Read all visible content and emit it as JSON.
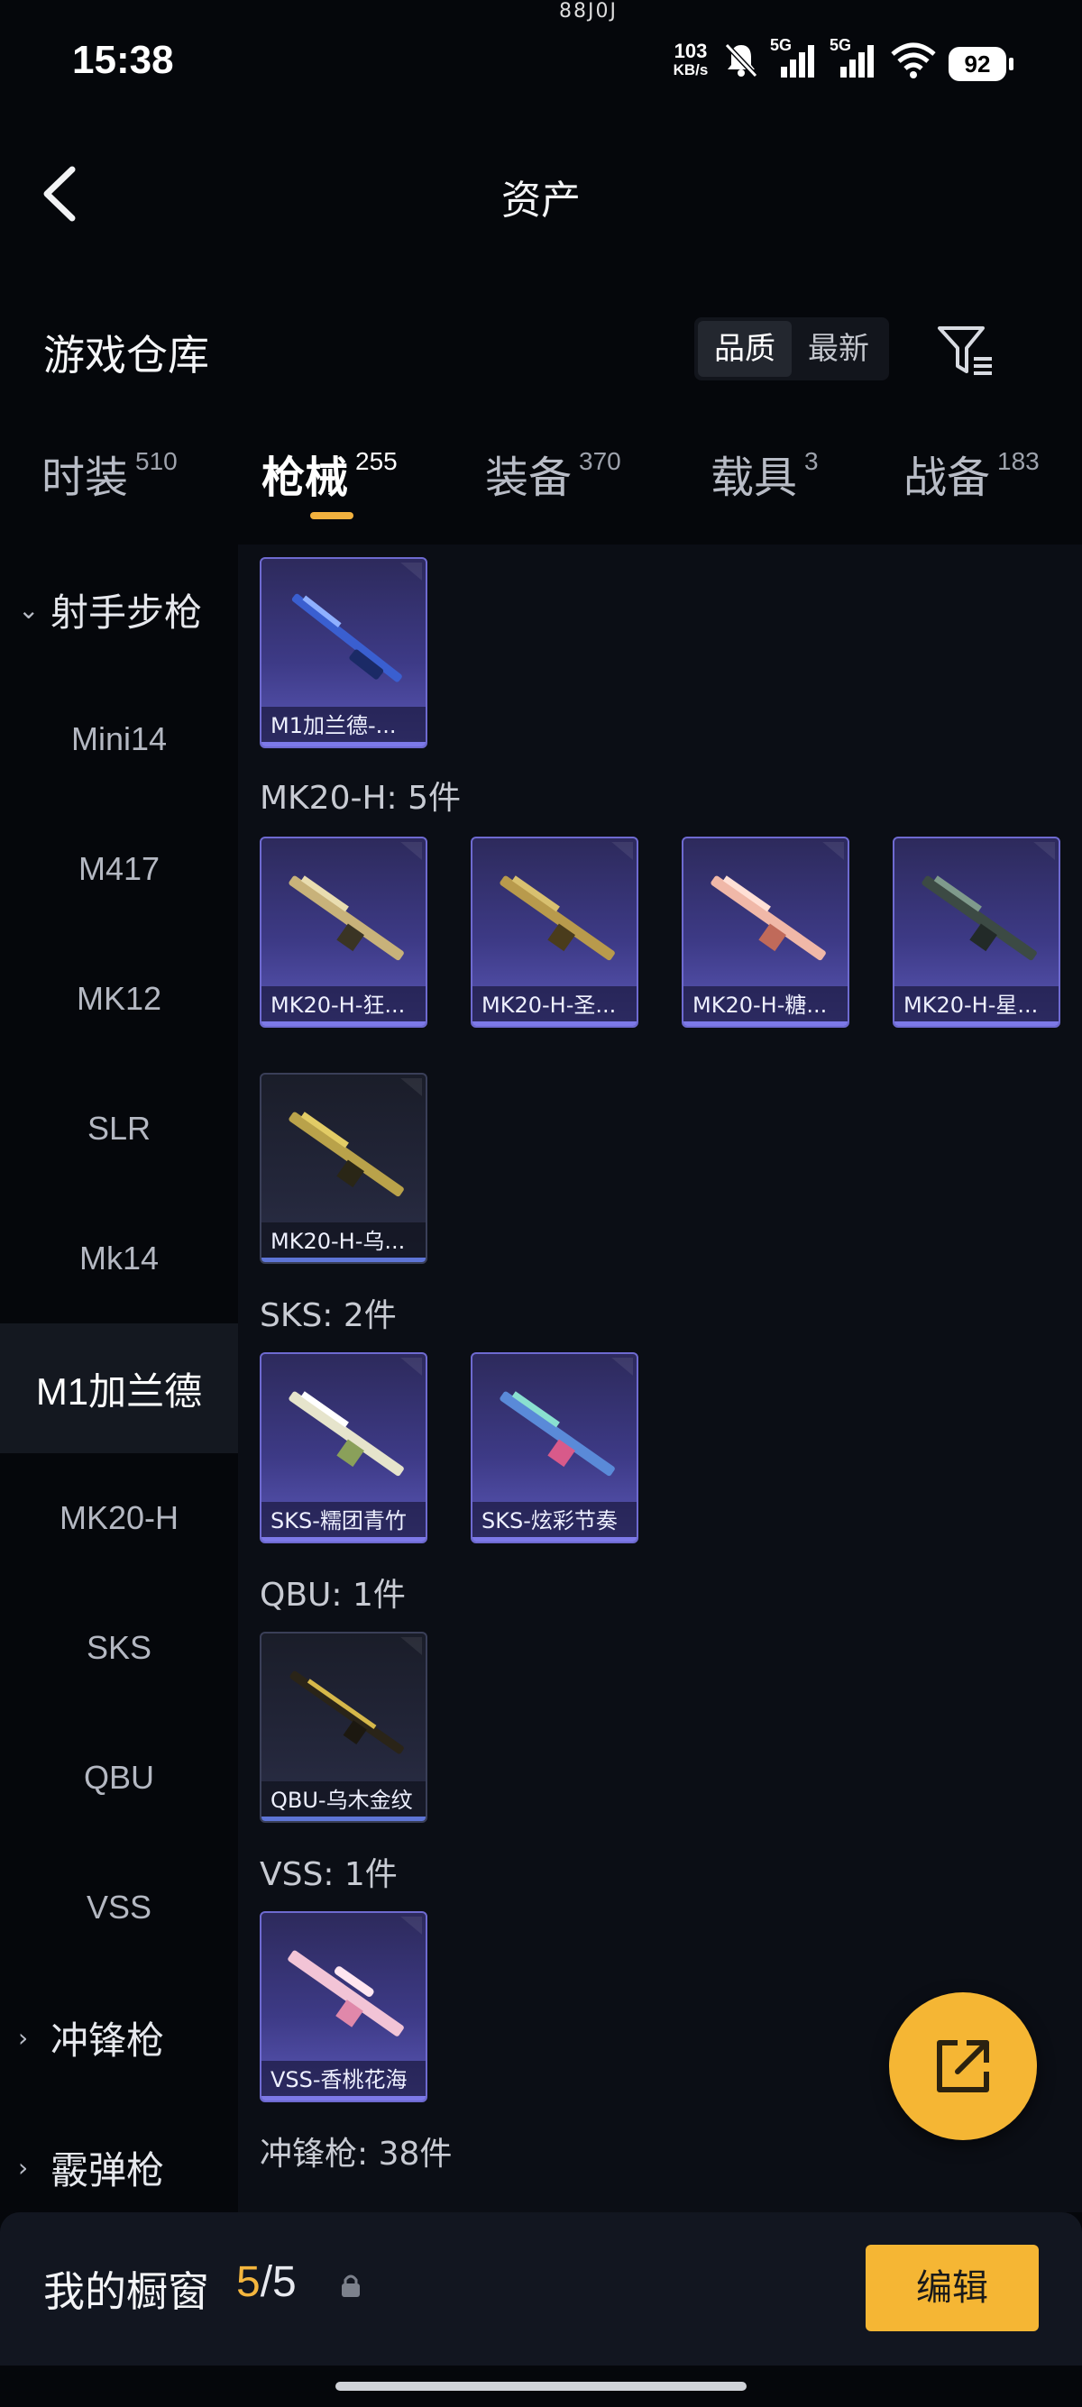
{
  "status_bar": {
    "time": "15:38",
    "top_dots": "88J0J",
    "net_speed_value": "103",
    "net_speed_unit": "KB/s",
    "signal1_label": "5G",
    "signal2_label": "5G",
    "battery": "92"
  },
  "header": {
    "title": "资产",
    "back_icon": "chevron-left-icon"
  },
  "warehouse": {
    "title": "游戏仓库",
    "sort_options": [
      "品质",
      "最新"
    ],
    "sort_selected": "品质",
    "filter_icon": "filter-icon"
  },
  "tabs": [
    {
      "label": "时装",
      "count": "510"
    },
    {
      "label": "枪械",
      "count": "255",
      "active": true
    },
    {
      "label": "装备",
      "count": "370"
    },
    {
      "label": "载具",
      "count": "3"
    },
    {
      "label": "战备",
      "count": "183"
    }
  ],
  "sidebar": {
    "group_open": "射手步枪",
    "items": [
      "Mini14",
      "M417",
      "MK12",
      "SLR",
      "Mk14",
      "M1加兰德",
      "MK20-H",
      "SKS",
      "QBU",
      "VSS"
    ],
    "active_item": "M1加兰德",
    "group_closed_1": "冲锋枪",
    "group_closed_2": "霰弹枪"
  },
  "content": {
    "m1_card": "M1加兰德-...",
    "mk20_label": "MK20-H: 5件",
    "mk20_cards": [
      "MK20-H-狂...",
      "MK20-H-圣...",
      "MK20-H-糖...",
      "MK20-H-星...",
      "MK20-H-乌..."
    ],
    "sks_label": "SKS: 2件",
    "sks_cards": [
      "SKS-糯团青竹",
      "SKS-炫彩节奏"
    ],
    "qbu_label": "QBU: 1件",
    "qbu_cards": [
      "QBU-乌木金纹"
    ],
    "vss_label": "VSS: 1件",
    "vss_cards": [
      "VSS-香桃花海"
    ],
    "smg_label": "冲锋枪: 38件"
  },
  "fab": {
    "icon": "share-external-icon"
  },
  "bottom_bar": {
    "label": "我的橱窗",
    "count_current": "5",
    "count_sep_total": "/5",
    "lock_icon": "lock-icon",
    "edit_label": "编辑"
  },
  "colors": {
    "accent": "#f5b634",
    "background": "#05070b",
    "content_bg": "#0b0e15",
    "card_purple": "#3d3a86",
    "card_dark": "#23263a"
  }
}
